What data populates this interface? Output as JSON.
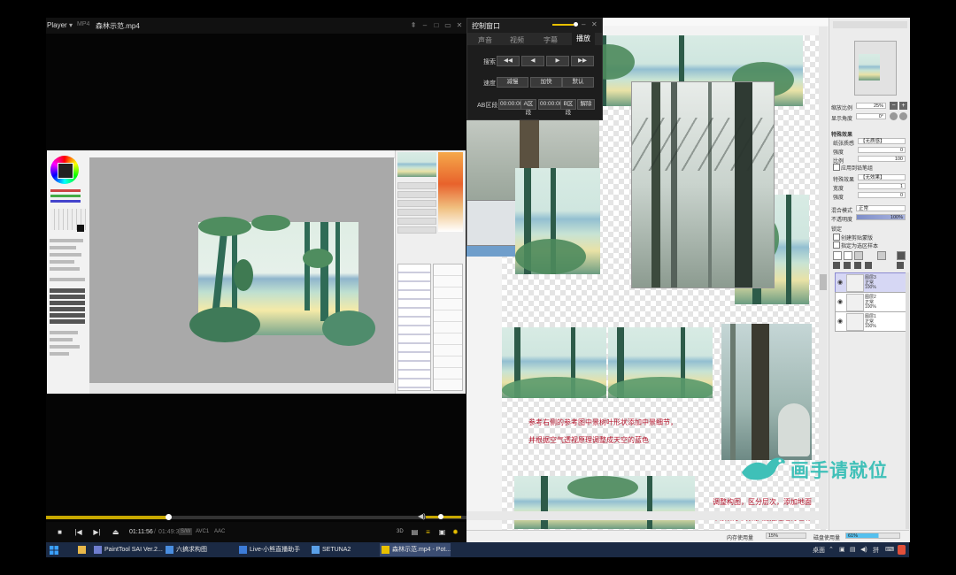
{
  "player": {
    "app_name": "Player",
    "format_badge": "MP4",
    "file_title": "森林示范.mp4",
    "controls": {
      "time_current": "01:11:56",
      "time_total": "01:49:33",
      "badge_sw": "S/W",
      "badge_video": "AVC1",
      "badge_audio": "AAC",
      "badge_3d": "3D",
      "progress": 0.29,
      "volume": 0.85
    }
  },
  "control_window": {
    "title": "控制窗口",
    "tabs": [
      "声音",
      "视频",
      "字幕",
      "播放"
    ],
    "active_tab": "播放",
    "seek_label": "搜索",
    "speed_label": "速度",
    "speed_buttons": [
      "减慢",
      "加快",
      "默认"
    ],
    "ab_label": "AB区段",
    "ab_start": "00:00:00",
    "ab_a": "A区段",
    "ab_end": "00:00:00",
    "ab_b": "B区段",
    "ab_clear": "解除"
  },
  "sai": {
    "notes": [
      "参考右侧的参考图中景树叶形状添加中景细节，",
      "并根据空气透视原理调整成天空的蓝色",
      "调整构图，区分层次，添加地面",
      "中景做了高保护度描边进行色彩"
    ],
    "panel": {
      "zoom_label": "缩放比例",
      "zoom_value": "25%",
      "angle_label": "显示角度",
      "angle_value": "0°",
      "effects_header": "特殊效果",
      "paper_texture_label": "纸张质感",
      "paper_texture_value": "【无质感】",
      "strength_label": "强度",
      "strength_value": "0",
      "scale_label": "比例",
      "scale_value": "100",
      "apply_to_brush": "应用到铅笔组",
      "special_effect_label": "特殊效果",
      "special_effect_value": "【无效果】",
      "width_label": "宽度",
      "width_value": "1",
      "intensity_label": "强度",
      "intensity_value": "0",
      "blend_label": "混合模式",
      "blend_value": "正常",
      "opacity_label": "不透明度",
      "opacity_value": "100%",
      "lock_label": "锁定",
      "clip_group": "创建剪贴蒙版",
      "select_source": "指定为选区样本",
      "layers": [
        {
          "name": "图层3",
          "mode": "正常",
          "opacity": "100%"
        },
        {
          "name": "图层2",
          "mode": "正常",
          "opacity": "100%"
        },
        {
          "name": "图层1",
          "mode": "正常",
          "opacity": "100%"
        }
      ]
    },
    "status": {
      "memory_label": "内存使用量",
      "memory_value": "15%",
      "disk_label": "磁盘使用量",
      "disk_value": "61%"
    }
  },
  "watermark": {
    "text": "画手请就位"
  },
  "taskbar": {
    "tasks": [
      "PaintTool SAI Ver.2...",
      "六搞求构图",
      "Live-小熊直播助手",
      "SETUNA2",
      "森林示范.mp4 - Pot..."
    ],
    "tray_text": "桌面"
  }
}
